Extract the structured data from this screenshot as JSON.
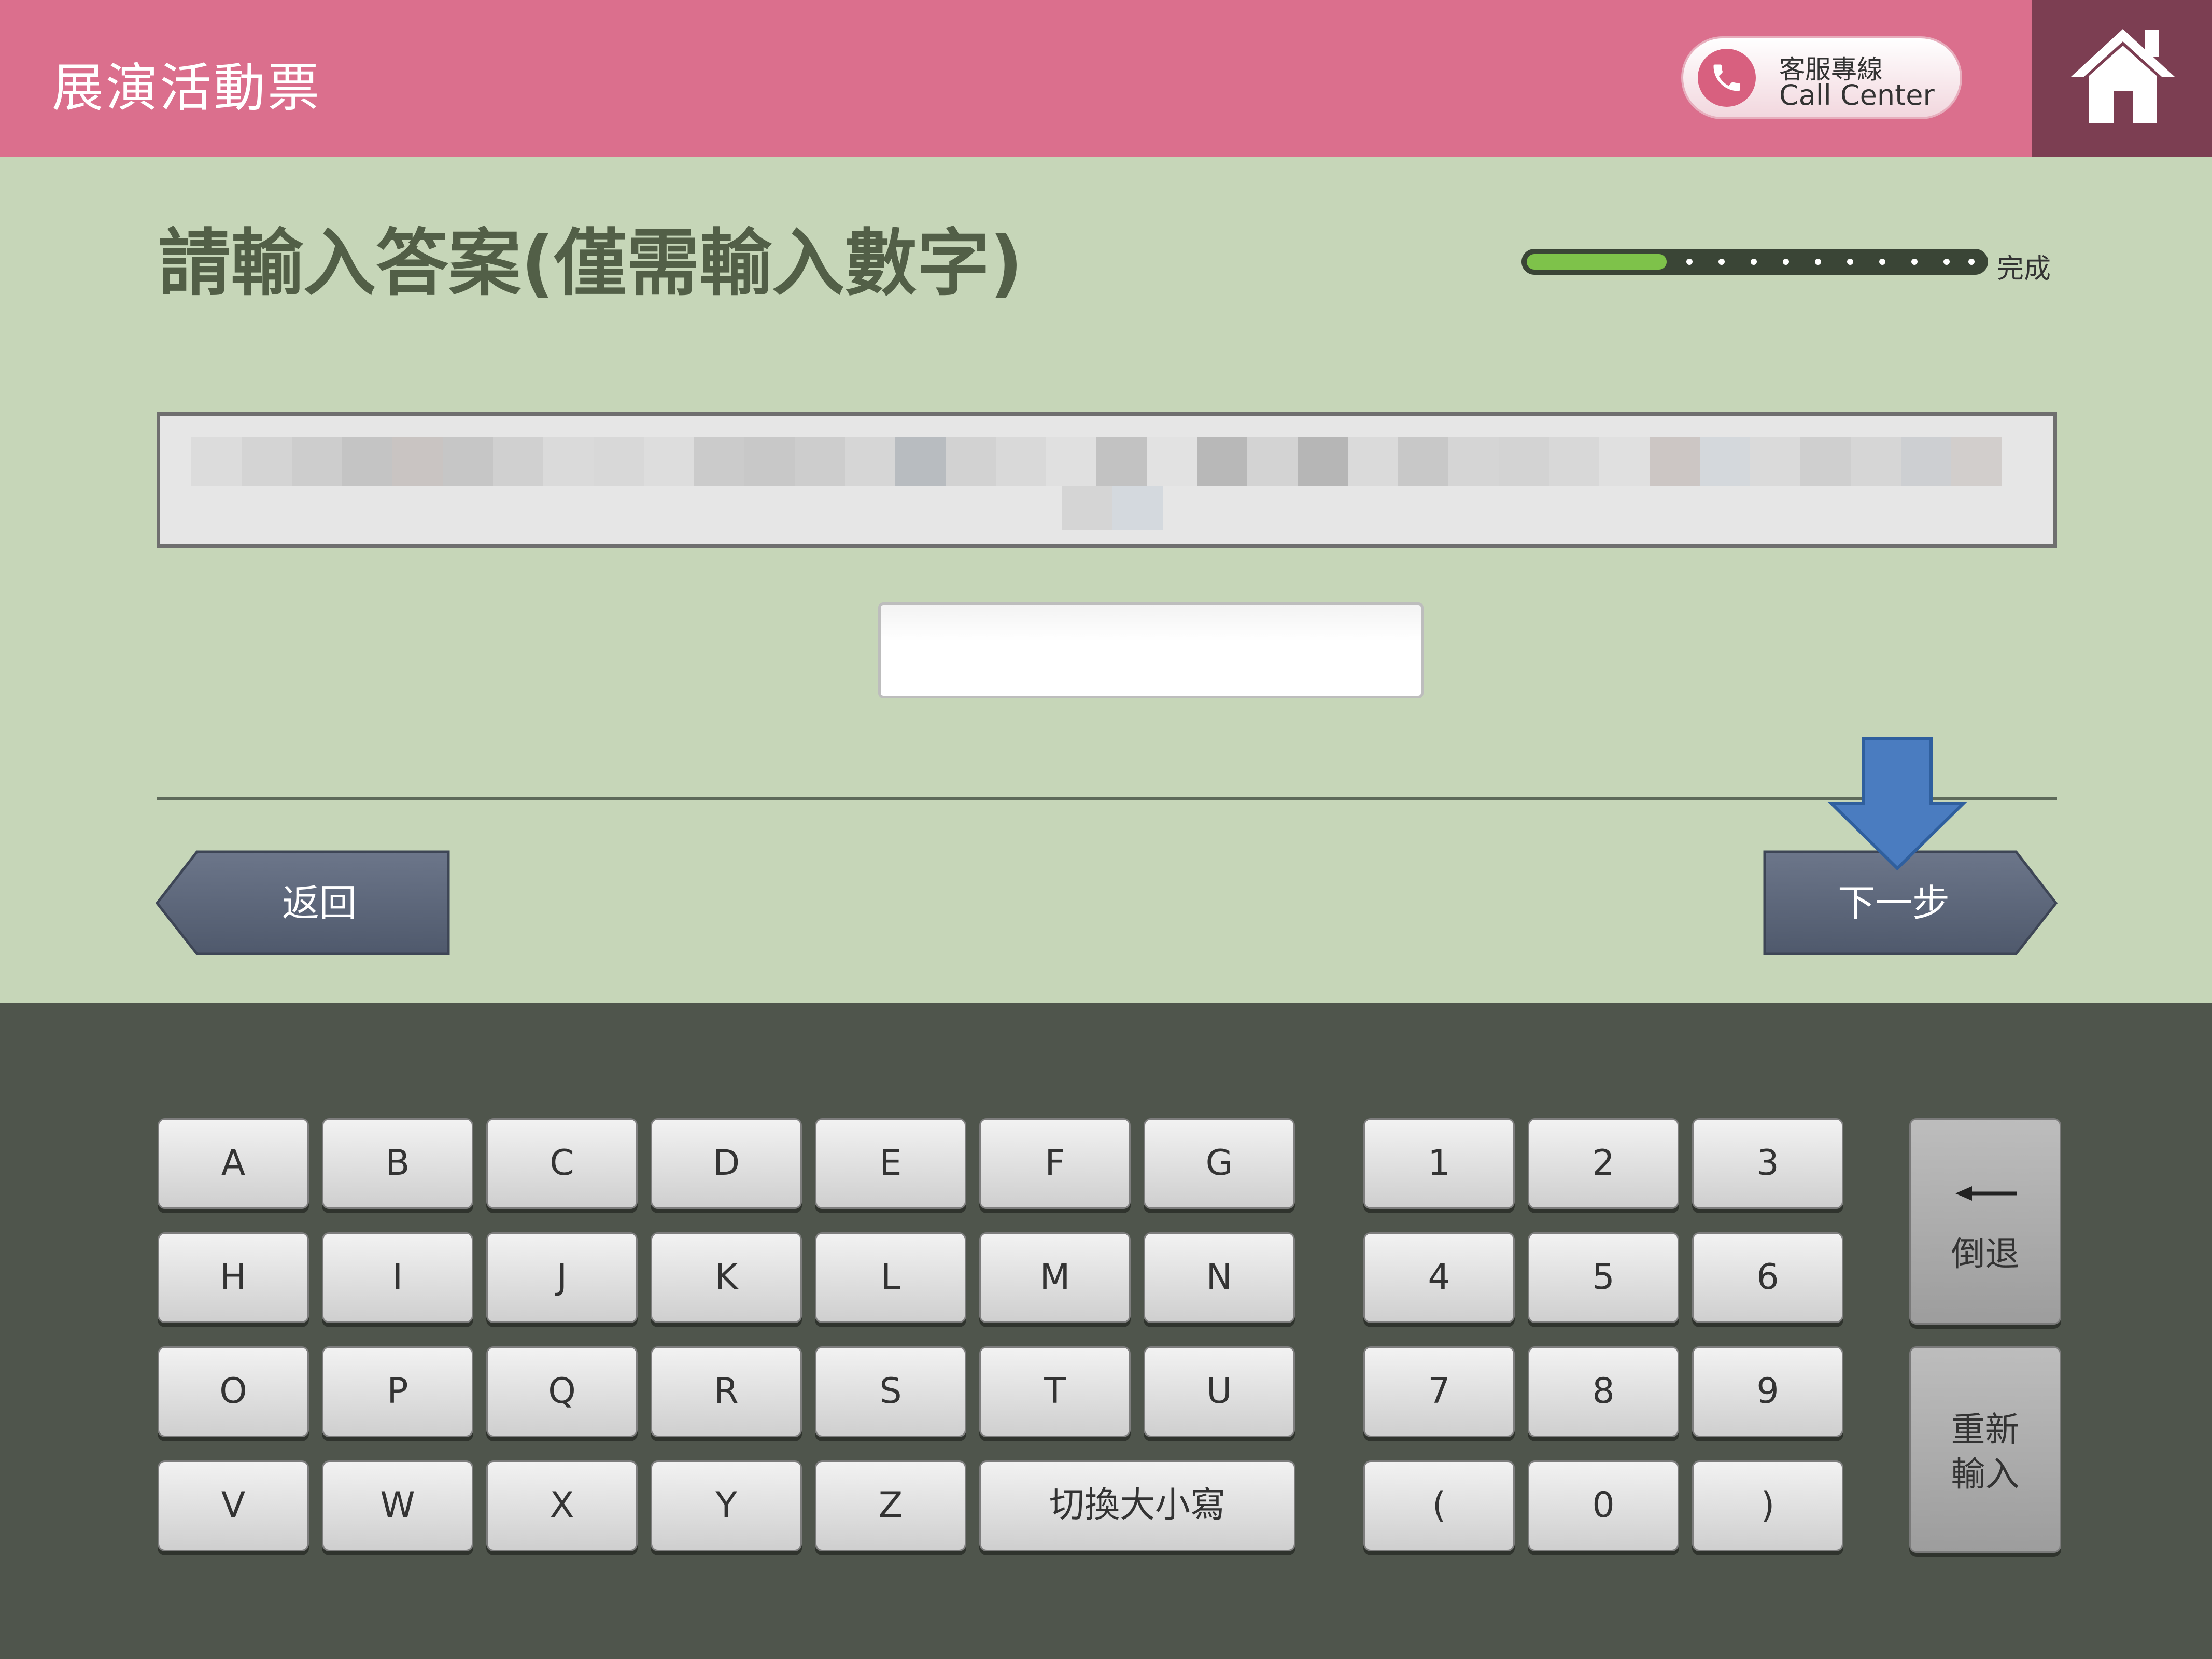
{
  "header": {
    "app_title": "展演活動票",
    "call_center": {
      "line1": "客服專線",
      "line2": "Call Center",
      "icon": "phone-icon"
    },
    "home_icon": "home-icon"
  },
  "main": {
    "title": "請輸入答案(僅需輸入數字)",
    "progress": {
      "label": "完成",
      "fraction_complete": 0.27
    },
    "question_text": "",
    "answer_value": "",
    "back_label": "返回",
    "next_label": "下一步"
  },
  "keyboard": {
    "letter_rows": [
      [
        "A",
        "B",
        "C",
        "D",
        "E",
        "F",
        "G"
      ],
      [
        "H",
        "I",
        "J",
        "K",
        "L",
        "M",
        "N"
      ],
      [
        "O",
        "P",
        "Q",
        "R",
        "S",
        "T",
        "U"
      ],
      [
        "V",
        "W",
        "X",
        "Y",
        "Z"
      ]
    ],
    "toggle_case_label": "切換大小寫",
    "number_rows": [
      [
        "1",
        "2",
        "3"
      ],
      [
        "4",
        "5",
        "6"
      ],
      [
        "7",
        "8",
        "9"
      ],
      [
        "(",
        "0",
        ")"
      ]
    ],
    "backspace_label": "倒退",
    "reset_label_line1": "重新",
    "reset_label_line2": "輸入"
  },
  "colors": {
    "header_bg": "#db6f8d",
    "home_bg": "#7c3e52",
    "content_bg": "#c6d6b8",
    "keyboard_bg": "#4f554c",
    "nav_button": "#5b6578",
    "arrow": "#4a7cc0",
    "progress_fill": "#7ec24a"
  }
}
